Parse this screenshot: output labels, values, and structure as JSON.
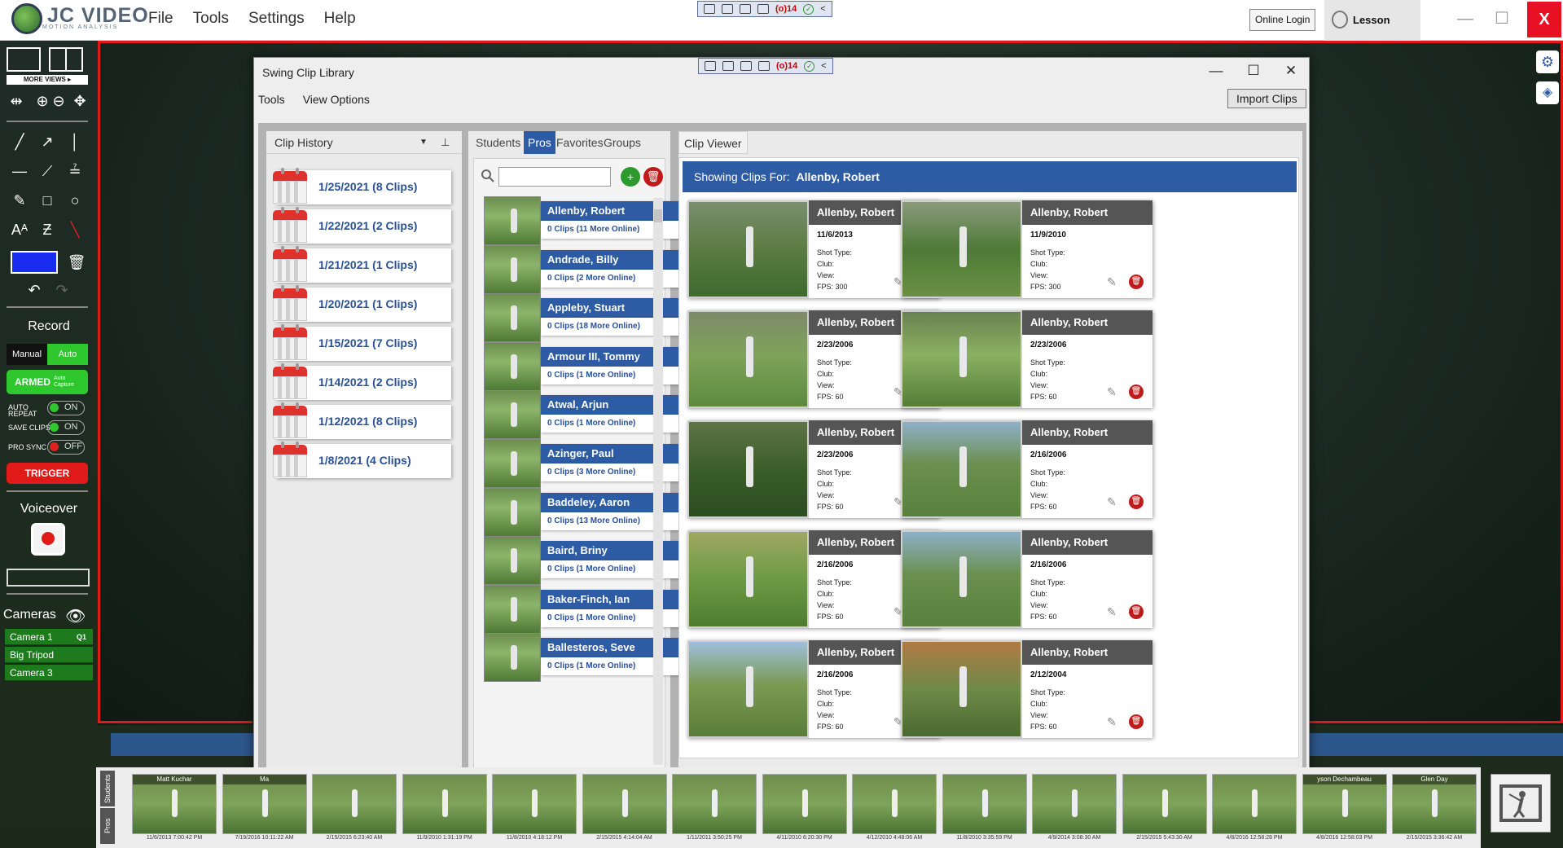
{
  "app": {
    "logo_text": "JC VIDEO",
    "logo_sub": "MOTION ANALYSIS",
    "menu": [
      "File",
      "Tools",
      "Settings",
      "Help"
    ],
    "online_login": "Online Login",
    "lesson_timer": "Lesson Timer",
    "min_glyph": "—",
    "max_glyph": "☐",
    "close_glyph": "X",
    "mini_toolbar": {
      "count": "14",
      "collapse": "<"
    }
  },
  "left_toolbar": {
    "more_views": "MORE VIEWS ▸",
    "record_title": "Record",
    "manual": "Manual",
    "auto": "Auto",
    "armed": "ARMED",
    "armed_sub": "Auto Capture",
    "auto_repeat": "AUTO REPEAT",
    "save_clips": "SAVE CLIPS",
    "pro_sync": "PRO SYNC",
    "on": "ON",
    "off": "OFF",
    "trigger": "TRIGGER",
    "voiceover": "Voiceover",
    "cameras_title": "Cameras",
    "cameras": [
      {
        "name": "Camera 1",
        "tag": "Q1"
      },
      {
        "name": "Big Tripod",
        "tag": ""
      },
      {
        "name": "Camera 3",
        "tag": ""
      }
    ],
    "pen_color": "#1a2cf0"
  },
  "dialog": {
    "title": "Swing Clip Library",
    "menu": [
      "Tools",
      "View Options"
    ],
    "import": "Import Clips",
    "clip_history": {
      "header": "Clip History",
      "items": [
        "1/25/2021 (8 Clips)",
        "1/22/2021 (2 Clips)",
        "1/21/2021 (1 Clips)",
        "1/20/2021 (1 Clips)",
        "1/15/2021 (7 Clips)",
        "1/14/2021 (2 Clips)",
        "1/12/2021 (8 Clips)",
        "1/8/2021 (4 Clips)"
      ]
    },
    "people": {
      "tabs": [
        "Students",
        "Pros",
        "Favorites",
        "Groups"
      ],
      "active_tab": "Pros",
      "search_value": "",
      "list": [
        {
          "name": "Allenby, Robert",
          "sub": "0 Clips  (11 More Online)"
        },
        {
          "name": "Andrade, Billy",
          "sub": "0 Clips  (2 More Online)"
        },
        {
          "name": "Appleby, Stuart",
          "sub": "0 Clips  (18 More Online)"
        },
        {
          "name": "Armour III, Tommy",
          "sub": "0 Clips  (1 More Online)"
        },
        {
          "name": "Atwal, Arjun",
          "sub": "0 Clips  (1 More Online)"
        },
        {
          "name": "Azinger, Paul",
          "sub": "0 Clips  (3 More Online)"
        },
        {
          "name": "Baddeley, Aaron",
          "sub": "0 Clips  (13 More Online)"
        },
        {
          "name": "Baird, Briny",
          "sub": "0 Clips  (1 More Online)"
        },
        {
          "name": "Baker-Finch, Ian",
          "sub": "0 Clips  (1 More Online)"
        },
        {
          "name": "Ballesteros, Seve",
          "sub": "0 Clips  (1 More Online)"
        }
      ]
    },
    "viewer": {
      "tab": "Clip Viewer",
      "showing_label": "Showing Clips For:",
      "showing_name": "Allenby, Robert",
      "shot_type_label": "Shot Type:",
      "club_label": "Club:",
      "view_label": "View:",
      "clips": [
        {
          "name": "Allenby, Robert",
          "date": "11/6/2013",
          "fps": "FPS: 300"
        },
        {
          "name": "Allenby, Robert",
          "date": "11/9/2010",
          "fps": "FPS: 300"
        },
        {
          "name": "Allenby, Robert",
          "date": "2/23/2006",
          "fps": "FPS: 60"
        },
        {
          "name": "Allenby, Robert",
          "date": "2/23/2006",
          "fps": "FPS: 60"
        },
        {
          "name": "Allenby, Robert",
          "date": "2/23/2006",
          "fps": "FPS: 60"
        },
        {
          "name": "Allenby, Robert",
          "date": "2/16/2006",
          "fps": "FPS: 60"
        },
        {
          "name": "Allenby, Robert",
          "date": "2/16/2006",
          "fps": "FPS: 60"
        },
        {
          "name": "Allenby, Robert",
          "date": "2/16/2006",
          "fps": "FPS: 60"
        },
        {
          "name": "Allenby, Robert",
          "date": "2/16/2006",
          "fps": "FPS: 60"
        },
        {
          "name": "Allenby, Robert",
          "date": "2/12/2004",
          "fps": "FPS: 60"
        }
      ]
    }
  },
  "filmstrip": {
    "tabs": [
      "Students",
      "Pros"
    ],
    "items": [
      {
        "title": "Matt Kuchar",
        "caption": "11/6/2013 7:00:42 PM"
      },
      {
        "title": "Ma",
        "caption": "7/19/2016 10:11:22 AM"
      },
      {
        "title": "",
        "caption": "2/15/2015 6:23:40 AM"
      },
      {
        "title": "",
        "caption": "11/9/2010 1:31:19 PM"
      },
      {
        "title": "",
        "caption": "11/8/2010 4:18:12 PM"
      },
      {
        "title": "",
        "caption": "2/15/2015 4:14:04 AM"
      },
      {
        "title": "",
        "caption": "1/11/2011 3:50:25 PM"
      },
      {
        "title": "",
        "caption": "4/11/2010 6:20:30 PM"
      },
      {
        "title": "",
        "caption": "4/12/2010 4:48:06 AM"
      },
      {
        "title": "",
        "caption": "11/8/2010 3:35:59 PM"
      },
      {
        "title": "",
        "caption": "4/9/2014 3:08:30 AM"
      },
      {
        "title": "",
        "caption": "2/15/2015 5:43:30 AM"
      },
      {
        "title": "",
        "caption": "4/8/2016 12:58:28 PM"
      },
      {
        "title": "yson Dechambeau",
        "caption": "4/8/2016 12:58:03 PM"
      },
      {
        "title": "Glen Day",
        "caption": "2/15/2015 3:36:42 AM"
      }
    ]
  }
}
